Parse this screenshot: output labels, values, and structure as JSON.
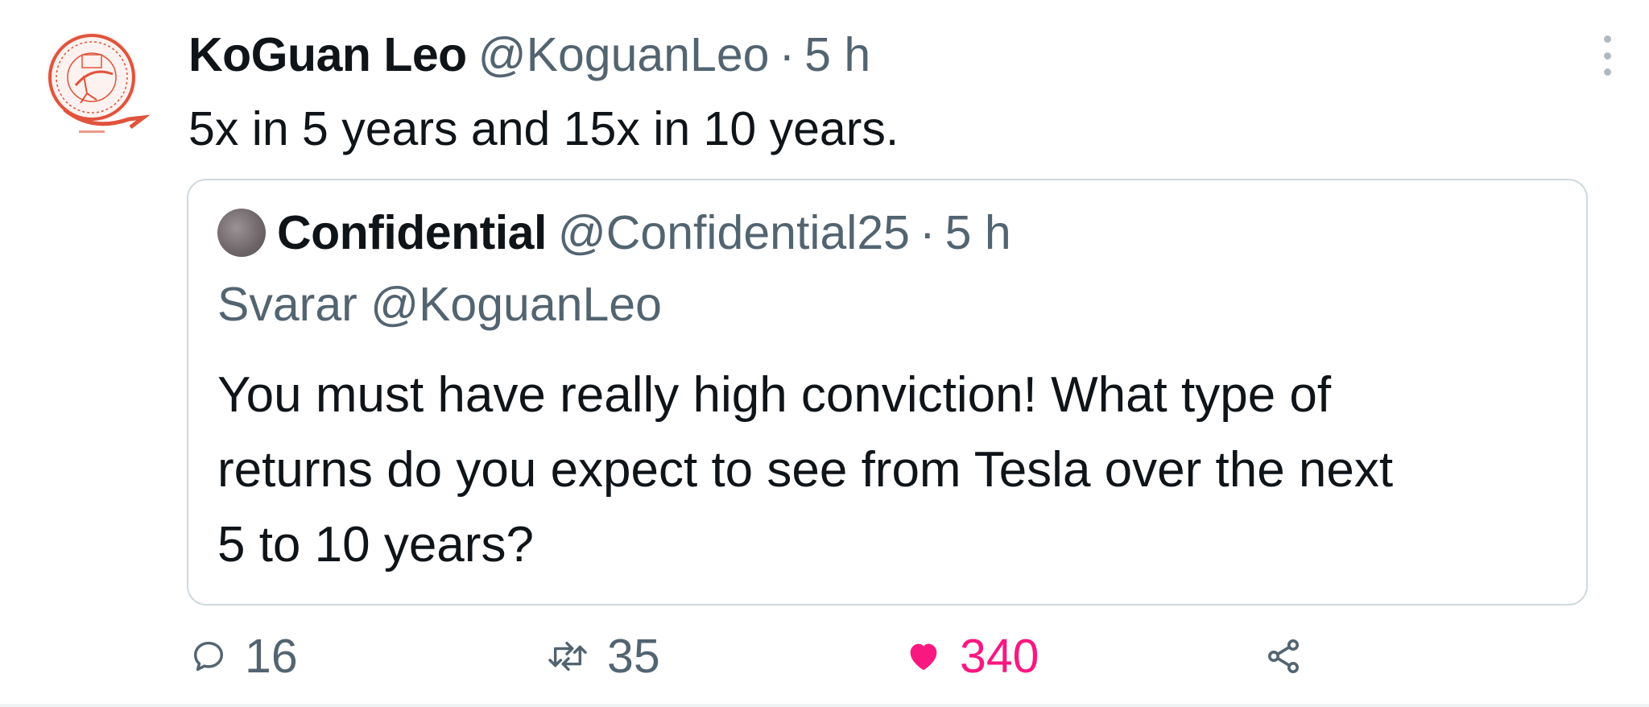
{
  "tweet": {
    "author": {
      "display_name": "KoGuan Leo",
      "handle": "@KoguanLeo",
      "separator": "·",
      "time": "5 h",
      "avatar_icon": "red-seal-avatar-icon"
    },
    "text": "5x in 5 years and 15x in 10 years.",
    "more_icon": "more-vertical-icon"
  },
  "quote": {
    "author": {
      "display_name": "Confidential",
      "handle": "@Confidential25",
      "separator": "·",
      "time": "5 h"
    },
    "reply_prefix": "Svarar",
    "reply_handle": "@KoguanLeo",
    "text": "You must have really high conviction!   What type of\nreturns do you expect to see from Tesla over the next\n5 to 10 years?"
  },
  "actions": {
    "replies": "16",
    "retweets": "35",
    "likes": "340",
    "share_icon": "share-icon"
  },
  "colors": {
    "text_primary": "#0f1419",
    "text_secondary": "#536471",
    "like_pink": "#f91880",
    "border": "#cfd9de",
    "avatar_red": "#e0533c"
  }
}
